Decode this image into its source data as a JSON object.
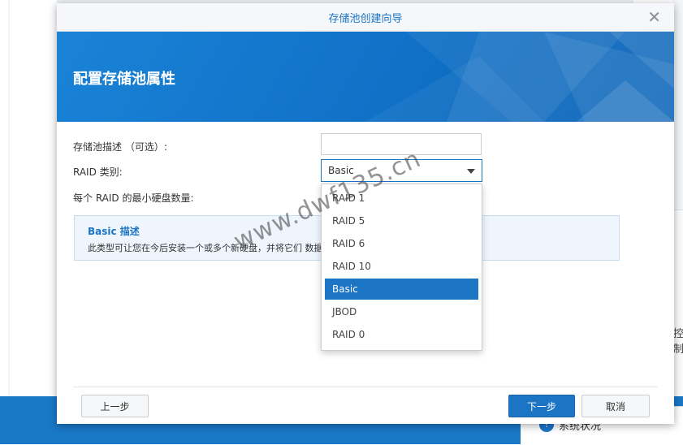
{
  "background": {
    "right_cut_text": "控制",
    "status_widget": {
      "icon": "info-icon",
      "label": "系统状况"
    }
  },
  "dialog": {
    "title": "存储池创建向导",
    "close_icon": "close-icon",
    "banner_title": "配置存储池属性",
    "form": {
      "description_label": "存储池描述 （可选）:",
      "description_value": "",
      "raid_type_label": "RAID 类别:",
      "raid_type_value": "Basic",
      "min_disks_label": "每个 RAID 的最小硬盘数量:"
    },
    "info": {
      "title": "Basic 描述",
      "text": "此类型可让您在今后安装一个或多个新硬盘，并将它们                                              数据冗余和数据保护。"
    },
    "dropdown_options": [
      "RAID 1",
      "RAID 5",
      "RAID 6",
      "RAID 10",
      "Basic",
      "JBOD",
      "RAID 0"
    ],
    "selected_option": "Basic",
    "buttons": {
      "prev": "上一步",
      "next": "下一步",
      "cancel": "取消"
    }
  },
  "watermark": "www.dwf135.cn",
  "colors": {
    "accent": "#1c74c4",
    "banner": "#1a83d7",
    "info_bg": "#eef5fc"
  }
}
